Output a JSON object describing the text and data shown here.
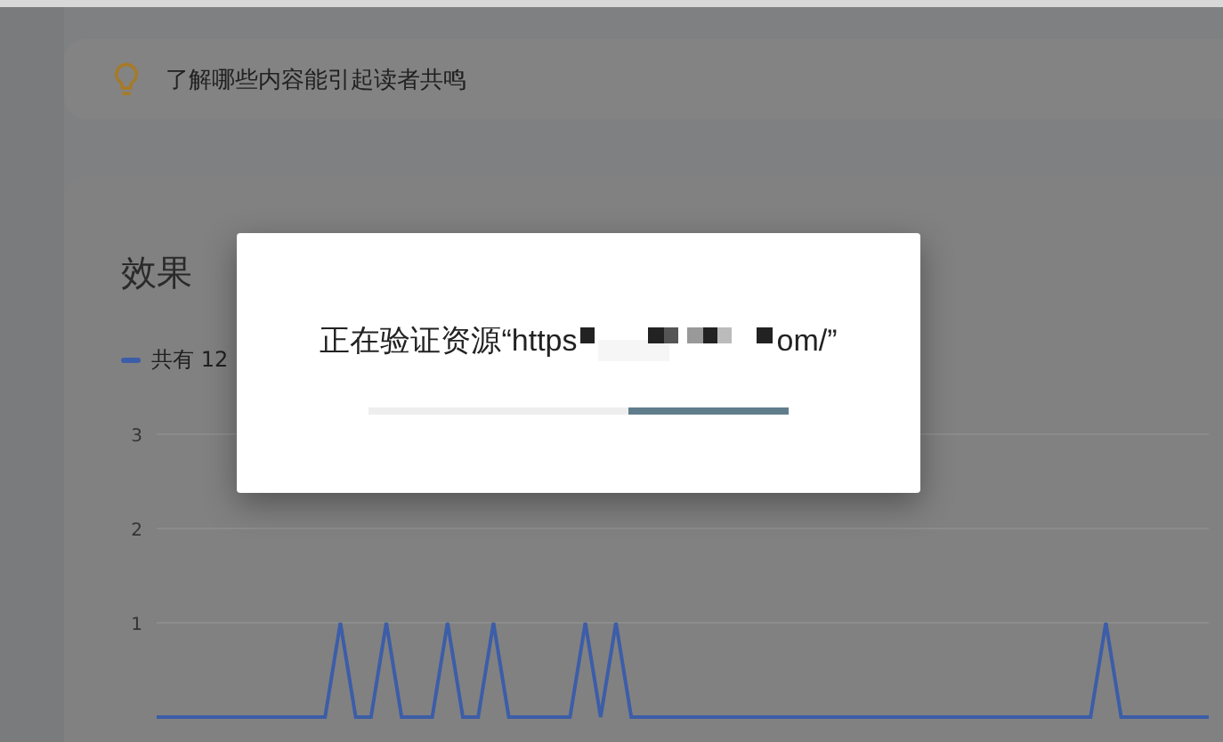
{
  "tip_card": {
    "text": "了解哪些内容能引起读者共鸣"
  },
  "performance_card": {
    "title": "效果",
    "legend": [
      {
        "label": "共有 12",
        "color": "#3c5da8"
      }
    ],
    "y_axis_labels": [
      "3",
      "2",
      "1"
    ]
  },
  "dialog": {
    "message_start": "正在验证资源“https",
    "message_end": "om/”",
    "progress": {
      "level": 0.38
    }
  }
}
